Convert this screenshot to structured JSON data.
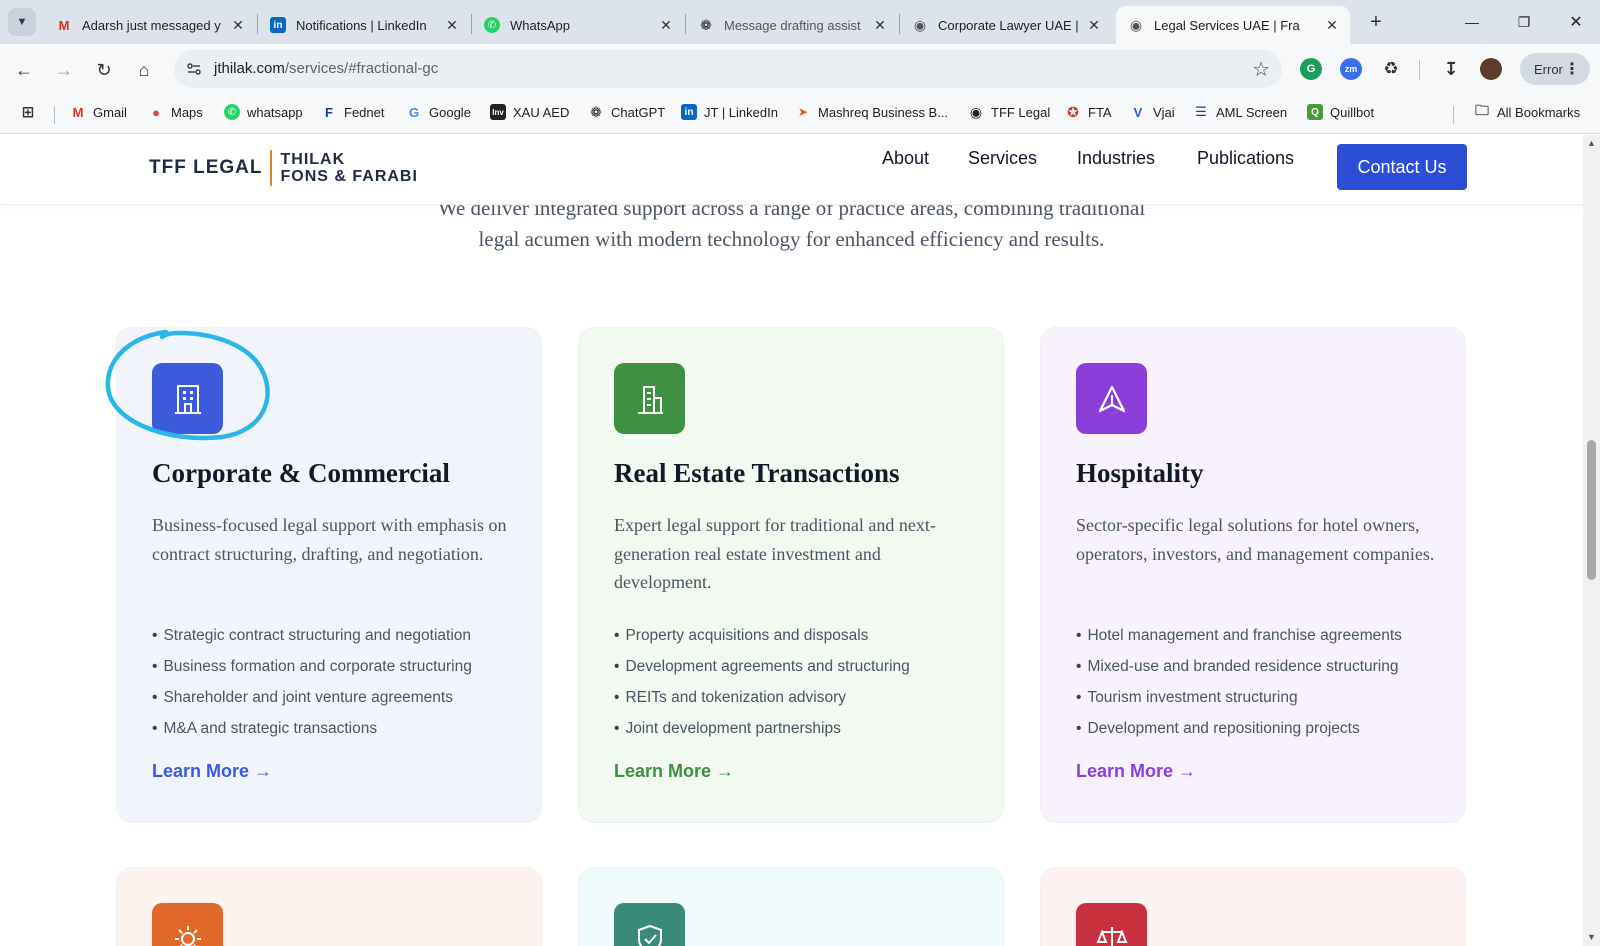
{
  "browser": {
    "tabs": [
      {
        "title": "Adarsh just messaged y",
        "icon": "gmail-icon"
      },
      {
        "title": "Notifications | LinkedIn",
        "icon": "linkedin-icon"
      },
      {
        "title": "WhatsApp",
        "icon": "whatsapp-icon"
      },
      {
        "title": "Message drafting assist",
        "icon": "chatgpt-icon"
      },
      {
        "title": "Corporate Lawyer UAE |",
        "icon": "globe-icon"
      },
      {
        "title": "Legal Services UAE | Fra",
        "icon": "globe-icon",
        "active": true
      }
    ],
    "close_glyph": "✕",
    "new_tab_glyph": "+",
    "window": {
      "minimize": "—",
      "restore": "❐",
      "close": "✕"
    },
    "url_host": "jthilak.com",
    "url_path": "/services/#fractional-gc",
    "profile_status": "Error",
    "bookmarks": [
      {
        "label": "Gmail",
        "icon": "gmail-icon"
      },
      {
        "label": "Maps",
        "icon": "maps-icon"
      },
      {
        "label": "whatsapp",
        "icon": "whatsapp-icon"
      },
      {
        "label": "Fednet",
        "icon": "fednet-icon"
      },
      {
        "label": "Google",
        "icon": "google-icon"
      },
      {
        "label": "XAU AED",
        "icon": "investing-icon"
      },
      {
        "label": "ChatGPT",
        "icon": "chatgpt-icon"
      },
      {
        "label": "JT | LinkedIn",
        "icon": "linkedin-icon"
      },
      {
        "label": "Mashreq Business B...",
        "icon": "mashreq-icon"
      },
      {
        "label": "TFF Legal",
        "icon": "globe-icon"
      },
      {
        "label": "FTA",
        "icon": "fta-icon"
      },
      {
        "label": "Vjai",
        "icon": "vjai-icon"
      },
      {
        "label": "AML Screen",
        "icon": "aml-icon"
      },
      {
        "label": "Quillbot",
        "icon": "quillbot-icon"
      }
    ],
    "all_bookmarks": "All Bookmarks"
  },
  "site": {
    "logo_short": "TFF LEGAL",
    "logo_line1": "THILAK",
    "logo_line2": "FONS & FARABI",
    "nav": [
      "About",
      "Services",
      "Industries",
      "Publications"
    ],
    "contact": "Contact Us",
    "intro_line1": "We deliver integrated support across a range of practice areas, combining traditional",
    "intro_line2": "legal acumen with modern technology for enhanced efficiency and results."
  },
  "cards": [
    {
      "title": "Corporate & Commercial",
      "description": "Business-focused legal support with emphasis on contract structuring, drafting, and negotiation.",
      "bullets": [
        "Strategic contract structuring and negotiation",
        "Business formation and corporate structuring",
        "Shareholder and joint venture agreements",
        "M&A and strategic transactions"
      ],
      "link": "Learn More →",
      "icon": "building-icon",
      "accent": "#3b5bdb"
    },
    {
      "title": "Real Estate Transactions",
      "description": "Expert legal support for traditional and next-generation real estate investment and development.",
      "bullets": [
        "Property acquisitions and disposals",
        "Development agreements and structuring",
        "REITs and tokenization advisory",
        "Joint development partnerships"
      ],
      "link": "Learn More →",
      "icon": "construction-building-icon",
      "accent": "#3f9142"
    },
    {
      "title": "Hospitality",
      "description": "Sector-specific legal solutions for hotel owners, operators, investors, and management companies.",
      "bullets": [
        "Hotel management and franchise agreements",
        "Mixed-use and branded residence structuring",
        "Tourism investment structuring",
        "Development and repositioning projects"
      ],
      "link": "Learn More →",
      "icon": "navigation-triangle-icon",
      "accent": "#8b3fd9"
    }
  ],
  "partial_cards": [
    {
      "icon": "sun-icon",
      "accent": "#e0692a"
    },
    {
      "icon": "shield-check-icon",
      "accent": "#3a8a7a"
    },
    {
      "icon": "scales-icon",
      "accent": "#c9303e"
    }
  ],
  "annotation_color": "#29b6e8"
}
